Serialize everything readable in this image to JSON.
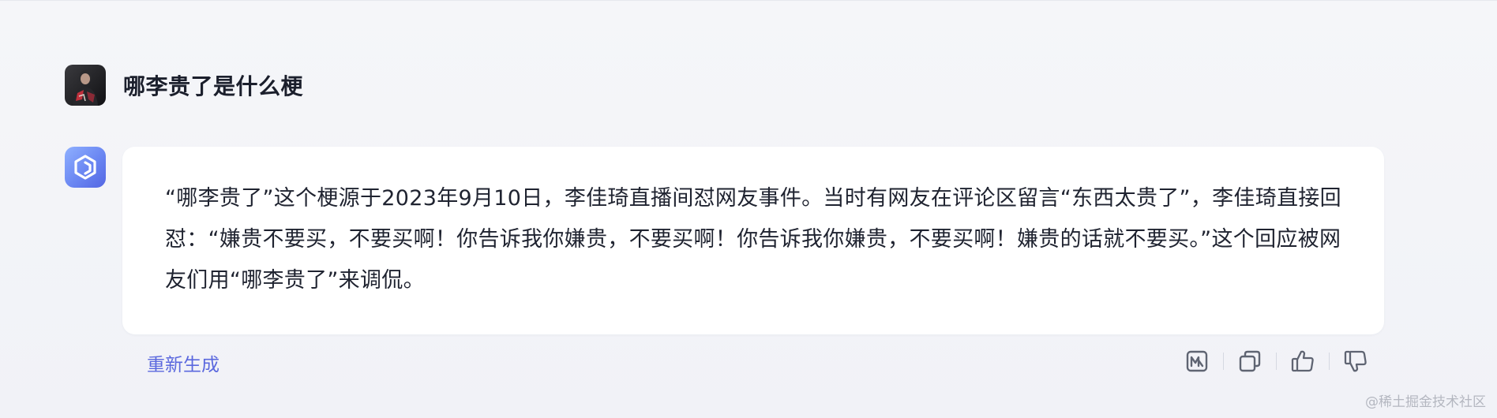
{
  "conversation": {
    "user": {
      "question": "哪李贵了是什么梗"
    },
    "assistant": {
      "answer": "“哪李贵了”这个梗源于2023年9月10日，李佳琦直播间怼网友事件。当时有网友在评论区留言“东西太贵了”，李佳琦直接回怼：“嫌贵不要买，不要买啊！你告诉我你嫌贵，不要买啊！你告诉我你嫌贵，不要买啊！嫌贵的话就不要买。”这个回应被网友们用“哪李贵了”来调侃。"
    }
  },
  "footer": {
    "regenerate_label": "重新生成",
    "actions": [
      {
        "icon": "mindmap-icon"
      },
      {
        "icon": "copy-icon"
      },
      {
        "icon": "thumbs-up-icon"
      },
      {
        "icon": "thumbs-down-icon"
      }
    ]
  },
  "watermark": "@稀土掘金技术社区",
  "colors": {
    "accent": "#5b68de",
    "icon": "#5f6472",
    "card": "#ffffff",
    "background": "#f3f4f8"
  }
}
